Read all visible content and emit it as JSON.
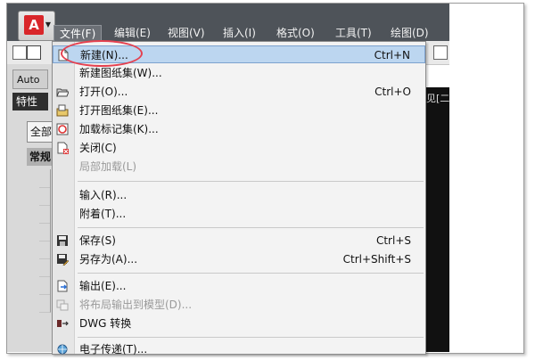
{
  "menubar": {
    "items": [
      {
        "label": "文件(F)"
      },
      {
        "label": "编辑(E)"
      },
      {
        "label": "视图(V)"
      },
      {
        "label": "插入(I)"
      },
      {
        "label": "格式(O)"
      },
      {
        "label": "工具(T)"
      },
      {
        "label": "绘图(D)"
      }
    ]
  },
  "app": {
    "logo_text": "A"
  },
  "left_panel": {
    "tab_label": "Auto",
    "properties_label": "特性",
    "select_all_label": "全部",
    "common_label": "常规"
  },
  "canvas": {
    "label": "见[二"
  },
  "file_menu": {
    "items": [
      {
        "label": "新建(N)...",
        "shortcut": "Ctrl+N",
        "icon": "new-file-icon",
        "disabled": false,
        "highlighted": true
      },
      {
        "label": "新建图纸集(W)...",
        "shortcut": "",
        "icon": "",
        "disabled": false
      },
      {
        "label": "打开(O)...",
        "shortcut": "Ctrl+O",
        "icon": "open-folder-icon",
        "disabled": false
      },
      {
        "label": "打开图纸集(E)...",
        "shortcut": "",
        "icon": "open-sheetset-icon",
        "disabled": false
      },
      {
        "label": "加载标记集(K)...",
        "shortcut": "",
        "icon": "markup-icon",
        "disabled": false
      },
      {
        "label": "关闭(C)",
        "shortcut": "",
        "icon": "close-doc-icon",
        "disabled": false
      },
      {
        "label": "局部加载(L)",
        "shortcut": "",
        "icon": "",
        "disabled": true
      },
      {
        "label": "输入(R)...",
        "shortcut": "",
        "icon": "",
        "disabled": false
      },
      {
        "label": "附着(T)...",
        "shortcut": "",
        "icon": "",
        "disabled": false
      },
      {
        "label": "保存(S)",
        "shortcut": "Ctrl+S",
        "icon": "save-icon",
        "disabled": false
      },
      {
        "label": "另存为(A)...",
        "shortcut": "Ctrl+Shift+S",
        "icon": "save-as-icon",
        "disabled": false
      },
      {
        "label": "输出(E)...",
        "shortcut": "",
        "icon": "export-icon",
        "disabled": false
      },
      {
        "label": "将布局输出到模型(D)...",
        "shortcut": "",
        "icon": "layout-export-icon",
        "disabled": true
      },
      {
        "label": "DWG 转换",
        "shortcut": "",
        "icon": "dwg-convert-icon",
        "disabled": false
      },
      {
        "label": "电子传递(T)...",
        "shortcut": "",
        "icon": "etransmit-icon",
        "disabled": false
      }
    ]
  },
  "colors": {
    "highlight": "#bcd6f0",
    "annotation_oval": "#e5404f",
    "menubar_bg": "#4e5359"
  }
}
